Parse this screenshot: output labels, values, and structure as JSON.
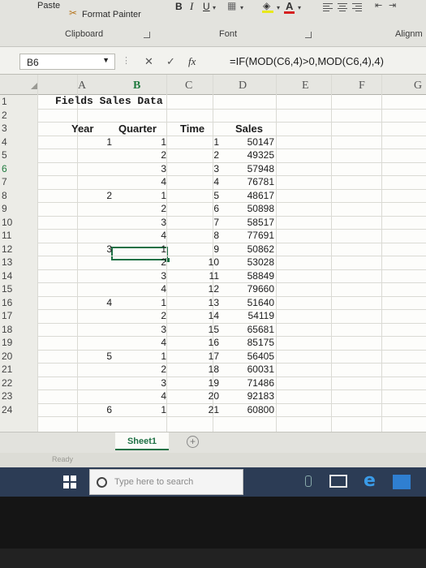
{
  "ribbon": {
    "paste_label": "Paste",
    "format_painter_label": "Format Painter",
    "clipboard_group": "Clipboard",
    "font_group": "Font",
    "alignment_group": "Alignm",
    "bold_label": "B",
    "italic_label": "I",
    "underline_label": "U",
    "font_color_label": "A"
  },
  "formula_bar": {
    "name_box": "B6",
    "cancel_symbol": "✕",
    "enter_symbol": "✓",
    "fx_label": "fx",
    "formula": "=IF(MOD(C6,4)>0,MOD(C6,4),4)"
  },
  "columns": [
    "A",
    "B",
    "C",
    "D",
    "E",
    "F",
    "G"
  ],
  "rows": [
    "1",
    "2",
    "3",
    "4",
    "5",
    "6",
    "7",
    "8",
    "9",
    "10",
    "11",
    "12",
    "13",
    "14",
    "15",
    "16",
    "17",
    "18",
    "19",
    "20",
    "21",
    "22",
    "23",
    "24"
  ],
  "sheet": {
    "title": "Fields Sales Data",
    "headers": {
      "year": "Year",
      "quarter": "Quarter",
      "time": "Time",
      "sales": "Sales"
    },
    "data": [
      {
        "year": "1",
        "quarter": "1",
        "time": "1",
        "sales": "50147"
      },
      {
        "year": "",
        "quarter": "2",
        "time": "2",
        "sales": "49325"
      },
      {
        "year": "",
        "quarter": "3",
        "time": "3",
        "sales": "57948"
      },
      {
        "year": "",
        "quarter": "4",
        "time": "4",
        "sales": "76781"
      },
      {
        "year": "2",
        "quarter": "1",
        "time": "5",
        "sales": "48617"
      },
      {
        "year": "",
        "quarter": "2",
        "time": "6",
        "sales": "50898"
      },
      {
        "year": "",
        "quarter": "3",
        "time": "7",
        "sales": "58517"
      },
      {
        "year": "",
        "quarter": "4",
        "time": "8",
        "sales": "77691"
      },
      {
        "year": "3",
        "quarter": "1",
        "time": "9",
        "sales": "50862"
      },
      {
        "year": "",
        "quarter": "2",
        "time": "10",
        "sales": "53028"
      },
      {
        "year": "",
        "quarter": "3",
        "time": "11",
        "sales": "58849"
      },
      {
        "year": "",
        "quarter": "4",
        "time": "12",
        "sales": "79660"
      },
      {
        "year": "4",
        "quarter": "1",
        "time": "13",
        "sales": "51640"
      },
      {
        "year": "",
        "quarter": "2",
        "time": "14",
        "sales": "54119"
      },
      {
        "year": "",
        "quarter": "3",
        "time": "15",
        "sales": "65681"
      },
      {
        "year": "",
        "quarter": "4",
        "time": "16",
        "sales": "85175"
      },
      {
        "year": "5",
        "quarter": "1",
        "time": "17",
        "sales": "56405"
      },
      {
        "year": "",
        "quarter": "2",
        "time": "18",
        "sales": "60031"
      },
      {
        "year": "",
        "quarter": "3",
        "time": "19",
        "sales": "71486"
      },
      {
        "year": "",
        "quarter": "4",
        "time": "20",
        "sales": "92183"
      },
      {
        "year": "6",
        "quarter": "1",
        "time": "21",
        "sales": "60800"
      }
    ]
  },
  "tabs": {
    "sheet1": "Sheet1",
    "add_symbol": "+"
  },
  "status": {
    "text": "Ready"
  },
  "taskbar": {
    "search_placeholder": "Type here to search"
  },
  "colors": {
    "accent": "#1e7145",
    "taskbar": "#2c3c55"
  }
}
